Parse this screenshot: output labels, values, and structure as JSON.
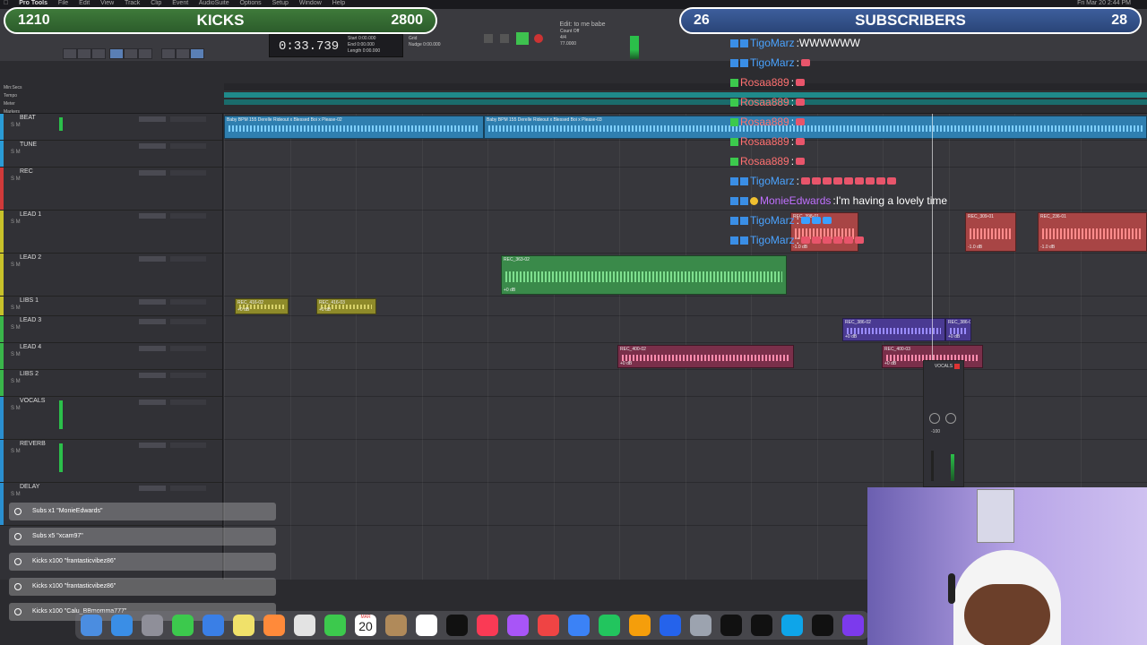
{
  "menubar": {
    "app": "Pro Tools",
    "items": [
      "File",
      "Edit",
      "View",
      "Track",
      "Clip",
      "Event",
      "AudioSuite",
      "Options",
      "Setup",
      "Window",
      "Help"
    ],
    "clock": "Fri Mar 20  2:44 PM"
  },
  "transport": {
    "main_counter": "0:33.739",
    "edit_window_title": "Edit: to me babe",
    "start": "0:00.000",
    "end": "0:00.000",
    "length": "0:00.000",
    "nudge": "0:00.000",
    "grid_label": "Grid",
    "nudge_label": "Nudge",
    "count_off": "Count Off",
    "meter": "4/4",
    "tempo": "77.0000"
  },
  "overlays": {
    "kicks": {
      "left": "1210",
      "label": "KICKS",
      "right": "2800"
    },
    "subs": {
      "left": "26",
      "label": "SUBSCRIBERS",
      "right": "28"
    }
  },
  "chat": [
    {
      "user": "TigoMarz",
      "color": "#4aa3ff",
      "text": "WWWWWW",
      "badges": [
        "prime",
        "sub"
      ]
    },
    {
      "user": "TigoMarz",
      "color": "#4aa3ff",
      "text": "",
      "badges": [
        "prime",
        "sub"
      ],
      "emotes": [
        "#e8556b"
      ]
    },
    {
      "user": "Rosaa889",
      "color": "#ff7070",
      "text": "",
      "badges": [
        "plus"
      ],
      "emotes": [
        "#e8556b"
      ]
    },
    {
      "user": "Rosaa889",
      "color": "#ff7070",
      "text": "",
      "badges": [
        "plus"
      ],
      "emotes": [
        "#e8556b"
      ]
    },
    {
      "user": "Rosaa889",
      "color": "#ff7070",
      "text": "",
      "badges": [
        "plus"
      ],
      "emotes": [
        "#e8556b"
      ]
    },
    {
      "user": "Rosaa889",
      "color": "#ff7070",
      "text": "",
      "badges": [
        "plus"
      ],
      "emotes": [
        "#e8556b"
      ]
    },
    {
      "user": "Rosaa889",
      "color": "#ff7070",
      "text": "",
      "badges": [
        "plus"
      ],
      "emotes": [
        "#e8556b"
      ]
    },
    {
      "user": "TigoMarz",
      "color": "#4aa3ff",
      "text": "",
      "badges": [
        "prime",
        "sub"
      ],
      "emotes": [
        "#e8556b",
        "#e8556b",
        "#e8556b",
        "#e8556b",
        "#e8556b",
        "#e8556b",
        "#e8556b",
        "#e8556b",
        "#e8556b"
      ]
    },
    {
      "user": "MonieEdwards",
      "color": "#c070ff",
      "text": "I'm having a lovely time",
      "badges": [
        "prime",
        "sub",
        "gold"
      ]
    },
    {
      "user": "TigoMarz",
      "color": "#4aa3ff",
      "text": "",
      "badges": [
        "prime",
        "sub"
      ],
      "emotes": [
        "#3aa0ff",
        "#3aa0ff",
        "#3aa0ff"
      ]
    },
    {
      "user": "TigoMarz",
      "color": "#4aa3ff",
      "text": "",
      "badges": [
        "prime",
        "sub"
      ],
      "emotes": [
        "#e8556b",
        "#e8556b",
        "#e8556b",
        "#e8556b",
        "#e8556b",
        "#e8556b"
      ]
    }
  ],
  "tracks": [
    {
      "name": "BEAT",
      "color": "#2a9bd6",
      "h": 30,
      "meter": 0.7
    },
    {
      "name": "TUNE",
      "color": "#2a9bd6",
      "h": 30,
      "meter": 0
    },
    {
      "name": "REC",
      "color": "#d03a3a",
      "h": 48,
      "meter": 0
    },
    {
      "name": "LEAD 1",
      "color": "#c7c12a",
      "h": 48,
      "meter": 0
    },
    {
      "name": "LEAD 2",
      "color": "#c7c12a",
      "h": 48,
      "meter": 0
    },
    {
      "name": "LIBS 1",
      "color": "#c7c12a",
      "h": 22,
      "meter": 0
    },
    {
      "name": "LEAD 3",
      "color": "#3ab54a",
      "h": 30,
      "meter": 0
    },
    {
      "name": "LEAD 4",
      "color": "#3ab54a",
      "h": 30,
      "meter": 0
    },
    {
      "name": "LIBS 2",
      "color": "#3ab54a",
      "h": 30,
      "meter": 0
    },
    {
      "name": "VOCALS",
      "color": "#2a8fd0",
      "h": 48,
      "meter": 0.8
    },
    {
      "name": "REVERB",
      "color": "#2a8fd0",
      "h": 48,
      "meter": 0.8
    },
    {
      "name": "DELAY",
      "color": "#2a8fd0",
      "h": 48,
      "meter": 0
    }
  ],
  "clips": [
    {
      "name": "Baby BPM 155 Derelle Rideout x Blessed Boi x Please-02",
      "gain": "",
      "lane": 0,
      "x0": 0.0,
      "x1": 0.282,
      "color": "#2f7fb0",
      "wave": "#7fd0ff"
    },
    {
      "name": "Baby BPM 155 Derelle Rideout x Blessed Boi x Please-03",
      "gain": "",
      "lane": 0,
      "x0": 0.282,
      "x1": 1.0,
      "color": "#2f7fb0",
      "wave": "#7fd0ff"
    },
    {
      "name": "REC_309-01",
      "gain": "-1.0 dB",
      "lane": 3,
      "x0": 0.803,
      "x1": 0.858,
      "color": "#a84545",
      "wave": "#ff8c8c"
    },
    {
      "name": "REC_236-01",
      "gain": "-1.0 dB",
      "lane": 3,
      "x0": 0.882,
      "x1": 1.0,
      "color": "#a84545",
      "wave": "#ff8c8c"
    },
    {
      "name": "REC_398-01",
      "gain": "-1.0 dB",
      "lane": 3,
      "x0": 0.614,
      "x1": 0.688,
      "color": "#a84545",
      "wave": "#ff8c8c"
    },
    {
      "name": "REC_363-02",
      "gain": "+0 dB",
      "lane": 4,
      "x0": 0.3,
      "x1": 0.61,
      "color": "#3a8a4a",
      "wave": "#7fe08f"
    },
    {
      "name": "REC_416-02",
      "gain": "+0 dB",
      "lane": 5,
      "x0": 0.012,
      "x1": 0.07,
      "color": "#8e8a2a",
      "wave": "#d8d26a"
    },
    {
      "name": "REC_416-03",
      "gain": "+0 dB",
      "lane": 5,
      "x0": 0.1,
      "x1": 0.165,
      "color": "#8e8a2a",
      "wave": "#d8d26a"
    },
    {
      "name": "REC_386-02",
      "gain": "+0 dB",
      "lane": 6,
      "x0": 0.67,
      "x1": 0.782,
      "color": "#4a3a92",
      "wave": "#9a8cff"
    },
    {
      "name": "REC_386-0",
      "gain": "+0 dB",
      "lane": 6,
      "x0": 0.782,
      "x1": 0.81,
      "color": "#4a3a92",
      "wave": "#9a8cff"
    },
    {
      "name": "REC_400-02",
      "gain": "+0 dB",
      "lane": 7,
      "x0": 0.426,
      "x1": 0.617,
      "color": "#7a2f4a",
      "wave": "#ff8cae"
    },
    {
      "name": "REC_400-03",
      "gain": "+0 dB",
      "lane": 7,
      "x0": 0.713,
      "x1": 0.823,
      "color": "#7a2f4a",
      "wave": "#ff8cae"
    }
  ],
  "alerts": [
    {
      "text": "Subs x1 \"MonieEdwards\""
    },
    {
      "text": "Subs x5 \"xcam97\""
    },
    {
      "text": "Kicks x100 \"frantasticvibez86\""
    },
    {
      "text": "Kicks x100 \"frantasticvibez86\""
    },
    {
      "text": "Kicks x100 \"Calu_BBmomma777\""
    }
  ],
  "dock": {
    "calendar_month": "MAR",
    "calendar_day": "20",
    "icons": [
      "finder-icon",
      "safari-icon",
      "launchpad-icon",
      "messages-icon",
      "mail-icon",
      "notes-icon",
      "photos-icon",
      "photos-alt-icon",
      "facetime-icon",
      "calendar-icon",
      "contacts-icon",
      "reminders-icon",
      "appletv-icon",
      "music-icon",
      "podcasts-icon",
      "news-icon",
      "keynote-icon",
      "numbers-icon",
      "pages-icon",
      "appstore-icon",
      "settings-icon",
      "protools-icon",
      "ilok-icon",
      "waves-icon",
      "oculus-icon",
      "obs-icon"
    ],
    "colors": [
      "#4b8de0",
      "#3a8ee6",
      "#8f8f99",
      "#3cc94d",
      "#3a7fe6",
      "#f0e16a",
      "#ff8a3a",
      "#e3e3e3",
      "#3cc94d",
      "#ffffff",
      "#b08a5a",
      "#ffffff",
      "#111111",
      "#fa3a55",
      "#a855f7",
      "#ef4444",
      "#3b82f6",
      "#22c55e",
      "#f59e0b",
      "#2563eb",
      "#9ca3af",
      "#111111",
      "#111111",
      "#0ea5e9",
      "#111111",
      "#7c3aed"
    ]
  },
  "plugin": {
    "title": "VOCALS",
    "vol_label": "vol",
    "pan_label": "pan",
    "value": "-100"
  }
}
